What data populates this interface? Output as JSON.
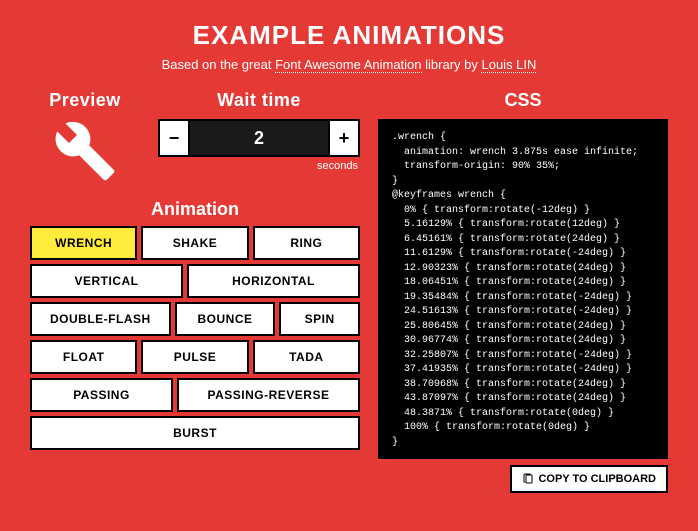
{
  "title": "Example animations",
  "subtitle": {
    "prefix": "Based on the great ",
    "link1": "Font Awesome Animation",
    "mid": " library by ",
    "link2": "Louis LIN"
  },
  "preview": {
    "heading": "Preview",
    "icon": "wrench-icon"
  },
  "wait": {
    "heading": "Wait time",
    "value": "2",
    "unit": "seconds",
    "minus": "−",
    "plus": "+"
  },
  "animation": {
    "heading": "Animation",
    "active": "WRENCH",
    "options": [
      "WRENCH",
      "SHAKE",
      "RING",
      "VERTICAL",
      "HORIZONTAL",
      "DOUBLE-FLASH",
      "BOUNCE",
      "SPIN",
      "FLOAT",
      "PULSE",
      "TADA",
      "PASSING",
      "PASSING-REVERSE",
      "BURST"
    ]
  },
  "css": {
    "heading": "CSS",
    "code": ".wrench {\n  animation: wrench 3.875s ease infinite;\n  transform-origin: 90% 35%;\n}\n@keyframes wrench {\n  0% { transform:rotate(-12deg) }\n  5.16129% { transform:rotate(12deg) }\n  6.45161% { transform:rotate(24deg) }\n  11.6129% { transform:rotate(-24deg) }\n  12.90323% { transform:rotate(24deg) }\n  18.06451% { transform:rotate(24deg) }\n  19.35484% { transform:rotate(-24deg) }\n  24.51613% { transform:rotate(-24deg) }\n  25.80645% { transform:rotate(24deg) }\n  30.96774% { transform:rotate(24deg) }\n  32.25807% { transform:rotate(-24deg) }\n  37.41935% { transform:rotate(-24deg) }\n  38.70968% { transform:rotate(24deg) }\n  43.87097% { transform:rotate(24deg) }\n  48.3871% { transform:rotate(0deg) }\n  100% { transform:rotate(0deg) }\n}"
  },
  "copy": {
    "label": "COPY TO CLIPBOARD"
  }
}
